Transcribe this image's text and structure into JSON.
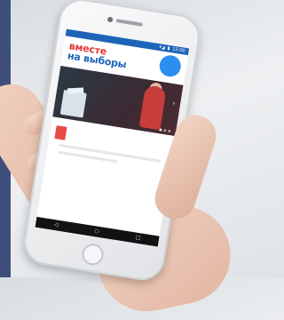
{
  "status_bar": {
    "signal": "▾◢",
    "battery": "▮",
    "time": "12:00"
  },
  "app": {
    "logo_line1": "вместе",
    "logo_line2": "на выборы",
    "badge_text": "",
    "banner_text": "",
    "cta_label": "",
    "link_label": "",
    "footer_text": ""
  },
  "nav_icons": {
    "back": "◁",
    "home": "○",
    "recent": "□"
  },
  "colors": {
    "accent_red": "#e84a44",
    "brand_blue": "#1d64b9",
    "badge_blue": "#2b8ef0"
  }
}
